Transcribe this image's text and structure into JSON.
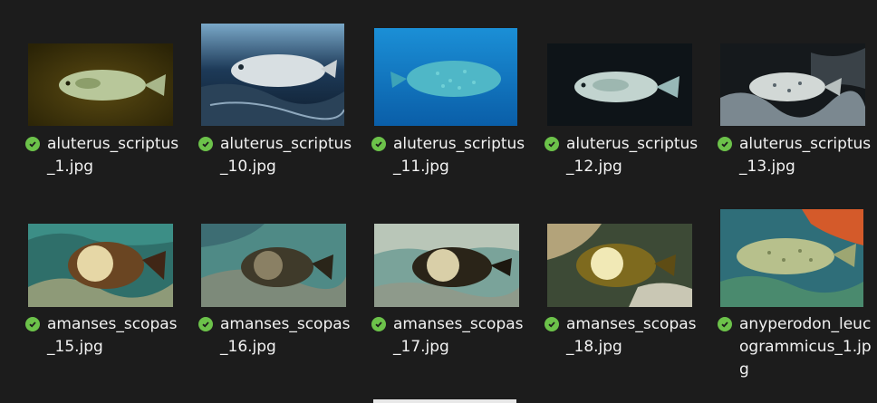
{
  "window": {
    "view": "Large icons"
  },
  "files": [
    {
      "name": "aluterus_scriptus_1.jpg",
      "status_icon": "synced-check-icon",
      "thumb": "filefish-olive"
    },
    {
      "name": "aluterus_scriptus_10.jpg",
      "status_icon": "synced-check-icon",
      "thumb": "filefish-blue-pale"
    },
    {
      "name": "aluterus_scriptus_11.jpg",
      "status_icon": "synced-check-icon",
      "thumb": "filefish-open-blue"
    },
    {
      "name": "aluterus_scriptus_12.jpg",
      "status_icon": "synced-check-icon",
      "thumb": "filefish-dark"
    },
    {
      "name": "aluterus_scriptus_13.jpg",
      "status_icon": "synced-check-icon",
      "thumb": "filefish-reef"
    },
    {
      "name": "amanses_scopas_15.jpg",
      "status_icon": "synced-check-icon",
      "thumb": "leatherjacket-reef"
    },
    {
      "name": "amanses_scopas_16.jpg",
      "status_icon": "synced-check-icon",
      "thumb": "leatherjacket-coral"
    },
    {
      "name": "amanses_scopas_17.jpg",
      "status_icon": "synced-check-icon",
      "thumb": "leatherjacket-sand"
    },
    {
      "name": "amanses_scopas_18.jpg",
      "status_icon": "synced-check-icon",
      "thumb": "leatherjacket-yellow"
    },
    {
      "name": "anyperodon_leucogrammicus_1.jpg",
      "status_icon": "synced-check-icon",
      "thumb": "grouper-reef"
    }
  ],
  "colors": {
    "background": "#1c1c1c",
    "text": "#f2f2f2",
    "sync_green": "#6cc24a"
  }
}
